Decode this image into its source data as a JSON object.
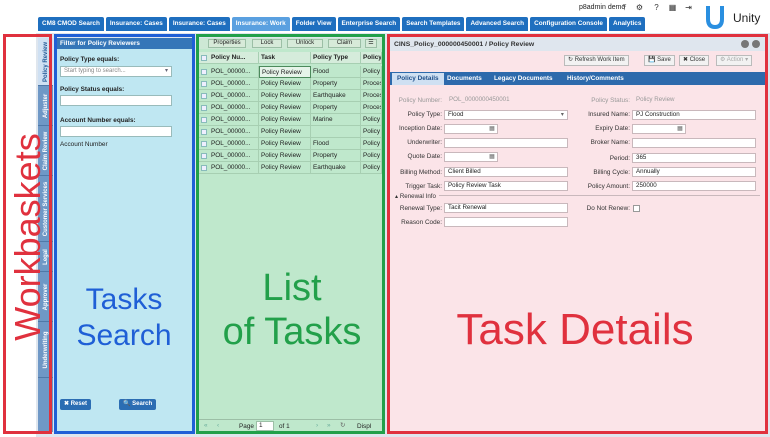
{
  "topbar": {
    "user": "p8admin",
    "user_suffix": "demo",
    "brand": "Unity"
  },
  "tabs": [
    {
      "label": "CM8 CMOD Search",
      "active": false
    },
    {
      "label": "Insurance: Cases",
      "active": false
    },
    {
      "label": "Insurance: Cases",
      "active": false
    },
    {
      "label": "Insurance: Work",
      "active": true
    },
    {
      "label": "Folder View",
      "active": false
    },
    {
      "label": "Enterprise Search",
      "active": false
    },
    {
      "label": "Search Templates",
      "active": false
    },
    {
      "label": "Advanced Search",
      "active": false
    },
    {
      "label": "Configuration Console",
      "active": false
    },
    {
      "label": "Analytics",
      "active": false
    }
  ],
  "workbaskets": [
    {
      "label": "Policy Review",
      "active": true
    },
    {
      "label": "Adjuster",
      "active": false
    },
    {
      "label": "Claim Review",
      "active": false
    },
    {
      "label": "Customer Services",
      "active": false
    },
    {
      "label": "Legal",
      "active": false
    },
    {
      "label": "Approver",
      "active": false
    },
    {
      "label": "Underwriting",
      "active": false
    }
  ],
  "filter": {
    "title": "Filter for Policy Reviewers",
    "policy_type_label": "Policy Type equals:",
    "policy_type_placeholder": "Start typing to search...",
    "policy_status_label": "Policy Status equals:",
    "account_number_label": "Account Number equals:",
    "account_number_text": "Account Number",
    "reset_label": "Reset",
    "search_label": "Search"
  },
  "task_toolbar": {
    "properties": "Properties",
    "lock": "Lock",
    "unlock": "Unlock",
    "claim": "Claim"
  },
  "task_table": {
    "columns": [
      "Policy Nu...",
      "Task",
      "Policy Type",
      "Policy"
    ],
    "rows": [
      {
        "policy": "POL_00000...",
        "task": "Policy Review",
        "type": "Flood",
        "status": "Policy",
        "selected": true
      },
      {
        "policy": "POL_00000...",
        "task": "Policy Review",
        "type": "Property",
        "status": "Proces",
        "selected": false
      },
      {
        "policy": "POL_00000...",
        "task": "Policy Review",
        "type": "Earthquake",
        "status": "Proces",
        "selected": false
      },
      {
        "policy": "POL_00000...",
        "task": "Policy Review",
        "type": "Property",
        "status": "Proces",
        "selected": false
      },
      {
        "policy": "POL_00000...",
        "task": "Policy Review",
        "type": "Marine",
        "status": "Policy",
        "selected": false
      },
      {
        "policy": "POL_00000...",
        "task": "Policy Review",
        "type": "",
        "status": "Policy",
        "selected": false
      },
      {
        "policy": "POL_00000...",
        "task": "Policy Review",
        "type": "Flood",
        "status": "Policy",
        "selected": false
      },
      {
        "policy": "POL_00000...",
        "task": "Policy Review",
        "type": "Property",
        "status": "Policy",
        "selected": false
      },
      {
        "policy": "POL_00000...",
        "task": "Policy Review",
        "type": "Earthquake",
        "status": "Policy",
        "selected": false
      }
    ]
  },
  "task_footer": {
    "page_label": "Page",
    "page_value": "1",
    "of_label": "of 1",
    "display_label": "Displ"
  },
  "details": {
    "title": "CINS_Policy_000000450001 / Policy Review",
    "refresh": "Refresh Work Item",
    "save": "Save",
    "close": "Close",
    "action": "Action",
    "tabs": [
      {
        "label": "Policy Details",
        "active": true
      },
      {
        "label": "Documents",
        "active": false
      },
      {
        "label": "Legacy Documents",
        "active": false
      },
      {
        "label": "History/Comments",
        "active": false
      }
    ],
    "fields_left": {
      "policy_number_label": "Policy Number:",
      "policy_number_value": "POL_0000000450001",
      "policy_type_label": "Policy Type:",
      "policy_type_value": "Flood",
      "inception_date_label": "Inception Date:",
      "underwriter_label": "Underwriter:",
      "quote_date_label": "Quote Date:",
      "billing_method_label": "Billing Method:",
      "billing_method_value": "Client Billed",
      "trigger_task_label": "Trigger Task:",
      "trigger_task_value": "Policy Review Task"
    },
    "fields_right": {
      "policy_status_label": "Policy Status:",
      "policy_status_value": "Policy Review",
      "insured_name_label": "Insured Name:",
      "insured_name_value": "PJ Construction",
      "expiry_date_label": "Expiry Date:",
      "broker_name_label": "Broker Name:",
      "period_label": "Period:",
      "period_value": "365",
      "billing_cycle_label": "Billing Cycle:",
      "billing_cycle_value": "Annually",
      "policy_amount_label": "Policy Amount:",
      "policy_amount_value": "250000"
    },
    "renewal": {
      "section_label": "Renewal Info",
      "renewal_type_label": "Renewal Type:",
      "renewal_type_value": "Tacit Renewal",
      "reason_code_label": "Reason Code:",
      "do_not_renew_label": "Do Not Renew:"
    }
  },
  "annotations": {
    "workbaskets": "Workbaskets",
    "tasks_search_line1": "Tasks",
    "tasks_search_line2": "Search",
    "list_line1": "List",
    "list_line2": "of Tasks",
    "task_details": "Task Details",
    "colors": {
      "red": "#e0313e",
      "blue": "#1f5fd6",
      "green": "#22a04a"
    }
  }
}
